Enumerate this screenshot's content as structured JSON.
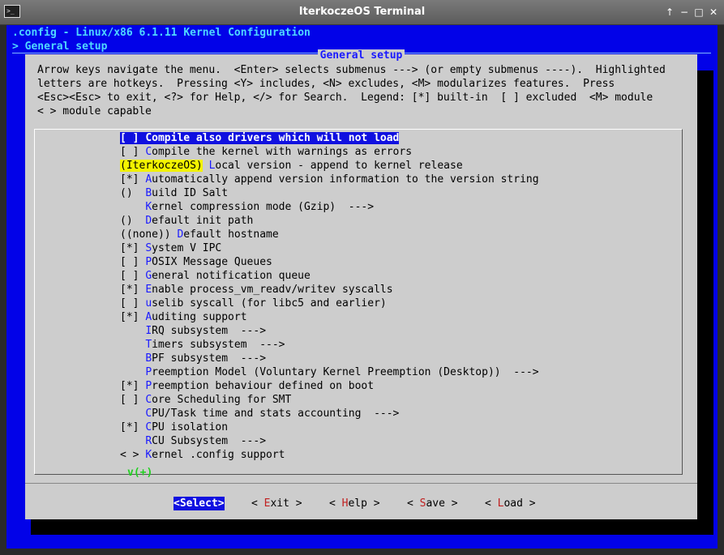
{
  "window": {
    "title": "IterkoczeOS Terminal",
    "controls": {
      "up": "↑",
      "minimize": "−",
      "maximize": "□",
      "close": "✕"
    }
  },
  "header": {
    "line1": ".config - Linux/x86 6.1.11 Kernel Configuration",
    "line2": "> General setup"
  },
  "dialog": {
    "title": "General setup",
    "help": [
      "Arrow keys navigate the menu.  <Enter> selects submenus ---> (or empty submenus ----).  Highlighted",
      "letters are hotkeys.  Pressing <Y> includes, <N> excludes, <M> modularizes features.  Press",
      "<Esc><Esc> to exit, <?> for Help, </> for Search.  Legend: [*] built-in  [ ] excluded  <M> module",
      "< > module capable"
    ]
  },
  "menu": {
    "items": [
      {
        "prefix": "[ ] ",
        "hotkey": "C",
        "rest": "ompile also drivers which will not load",
        "selected": true
      },
      {
        "prefix": "[ ] ",
        "hotkey": "C",
        "rest": "ompile the kernel with warnings as errors"
      },
      {
        "prefix": "(IterkoczeOS)",
        "sep": " ",
        "hotkey": "L",
        "rest": "ocal version - append to kernel release"
      },
      {
        "prefix": "[*] ",
        "hotkey": "A",
        "rest": "utomatically append version information to the version string"
      },
      {
        "prefix": "()  ",
        "hotkey": "B",
        "rest": "uild ID Salt"
      },
      {
        "prefix": "    ",
        "hotkey": "K",
        "rest": "ernel compression mode (Gzip)  --->"
      },
      {
        "prefix": "()  ",
        "hotkey": "D",
        "rest": "efault init path"
      },
      {
        "prefix": "((none)) ",
        "hotkey": "D",
        "rest": "efault hostname"
      },
      {
        "prefix": "[*] ",
        "hotkey": "S",
        "rest": "ystem V IPC"
      },
      {
        "prefix": "[ ] ",
        "hotkey": "P",
        "rest": "OSIX Message Queues"
      },
      {
        "prefix": "[ ] ",
        "hotkey": "G",
        "rest": "eneral notification queue"
      },
      {
        "prefix": "[*] ",
        "hotkey": "E",
        "rest": "nable process_vm_readv/writev syscalls"
      },
      {
        "prefix": "[ ] ",
        "hotkey": "u",
        "rest": "selib syscall (for libc5 and earlier)"
      },
      {
        "prefix": "[*] ",
        "hotkey": "A",
        "rest": "uditing support"
      },
      {
        "prefix": "    ",
        "hotkey": "I",
        "rest": "RQ subsystem  --->"
      },
      {
        "prefix": "    ",
        "hotkey": "T",
        "rest": "imers subsystem  --->"
      },
      {
        "prefix": "    ",
        "hotkey": "B",
        "rest": "PF subsystem  --->"
      },
      {
        "prefix": "    ",
        "hotkey": "P",
        "rest": "reemption Model (Voluntary Kernel Preemption (Desktop))  --->"
      },
      {
        "prefix": "[*] ",
        "hotkey": "P",
        "rest": "reemption behaviour defined on boot"
      },
      {
        "prefix": "[ ] ",
        "hotkey": "C",
        "rest": "ore Scheduling for SMT"
      },
      {
        "prefix": "    ",
        "hotkey": "C",
        "rest": "PU/Task time and stats accounting  --->"
      },
      {
        "prefix": "[*] ",
        "hotkey": "C",
        "rest": "PU isolation"
      },
      {
        "prefix": "    ",
        "hotkey": "R",
        "rest": "CU Subsystem  --->"
      },
      {
        "prefix": "< > ",
        "hotkey": "K",
        "rest": "ernel .config support"
      }
    ],
    "more_indicator": "v(+)"
  },
  "buttons": [
    {
      "label": "<Select>",
      "active": true
    },
    {
      "lt": "< ",
      "hotkey": "E",
      "rest": "xit",
      "gt": " >"
    },
    {
      "lt": "< ",
      "hotkey": "H",
      "rest": "elp",
      "gt": " >"
    },
    {
      "lt": "< ",
      "hotkey": "S",
      "rest": "ave",
      "gt": " >"
    },
    {
      "lt": "< ",
      "hotkey": "L",
      "rest": "oad",
      "gt": " >"
    }
  ],
  "colors": {
    "terminal_bg": "#0202e8",
    "dialog_bg": "#cdcdcd",
    "hotkey": "#1a1aff",
    "selection": "#1010e0",
    "value_highlight": "#f3f300"
  }
}
